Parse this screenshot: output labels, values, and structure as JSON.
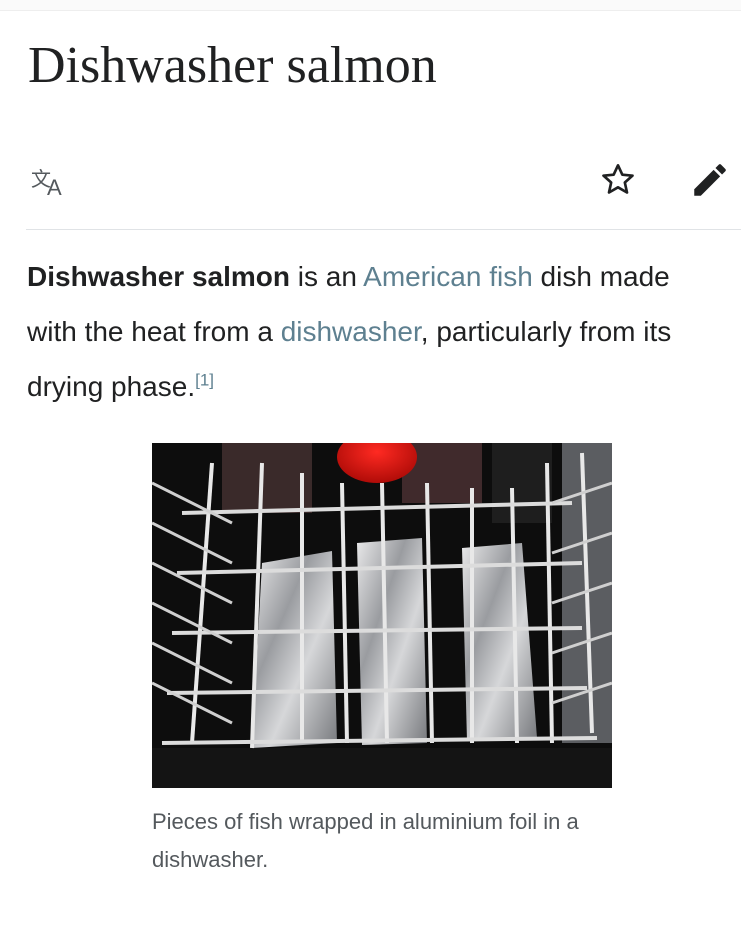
{
  "article": {
    "title": "Dishwasher salmon",
    "lead": {
      "bold_term": "Dishwasher salmon",
      "text_1": " is an ",
      "link_american": "American",
      "text_2": " ",
      "link_fish": "fish",
      "text_3": " dish made with the heat from a ",
      "link_dishwasher": "dishwasher",
      "text_4": ", particularly from its drying phase.",
      "citation": "[1]"
    },
    "figure": {
      "caption": "Pieces of fish wrapped in aluminium foil in a dishwasher."
    }
  },
  "toolbar": {
    "language_icon": "translate-icon",
    "watch_icon": "star-icon",
    "edit_icon": "pencil-icon"
  },
  "colors": {
    "text": "#202122",
    "link": "#5e8090",
    "caption": "#54595d",
    "divider": "#e0e3e6"
  }
}
